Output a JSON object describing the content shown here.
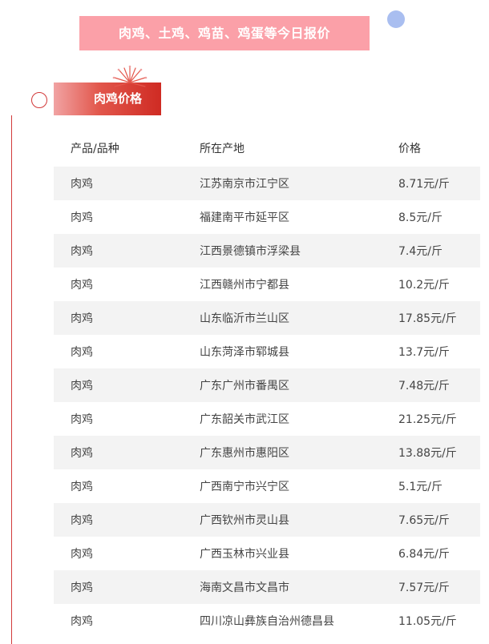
{
  "header": {
    "banner_title": "肉鸡、土鸡、鸡苗、鸡蛋等今日报价"
  },
  "section": {
    "title": "肉鸡价格"
  },
  "colors": {
    "banner_bg": "#fba0a8",
    "accent_red": "#d23a3a",
    "dot_blue": "#a9bef0",
    "row_shade": "#f3f3f3"
  },
  "table": {
    "columns": [
      "产品/品种",
      "所在产地",
      "价格"
    ],
    "rows": [
      {
        "product": "肉鸡",
        "origin": "江苏南京市江宁区",
        "price": "8.71元/斤"
      },
      {
        "product": "肉鸡",
        "origin": "福建南平市延平区",
        "price": "8.5元/斤"
      },
      {
        "product": "肉鸡",
        "origin": "江西景德镇市浮梁县",
        "price": "7.4元/斤"
      },
      {
        "product": "肉鸡",
        "origin": "江西赣州市宁都县",
        "price": "10.2元/斤"
      },
      {
        "product": "肉鸡",
        "origin": "山东临沂市兰山区",
        "price": "17.85元/斤"
      },
      {
        "product": "肉鸡",
        "origin": "山东菏泽市郓城县",
        "price": "13.7元/斤"
      },
      {
        "product": "肉鸡",
        "origin": "广东广州市番禺区",
        "price": "7.48元/斤"
      },
      {
        "product": "肉鸡",
        "origin": "广东韶关市武江区",
        "price": "21.25元/斤"
      },
      {
        "product": "肉鸡",
        "origin": "广东惠州市惠阳区",
        "price": "13.88元/斤"
      },
      {
        "product": "肉鸡",
        "origin": "广西南宁市兴宁区",
        "price": "5.1元/斤"
      },
      {
        "product": "肉鸡",
        "origin": "广西钦州市灵山县",
        "price": "7.65元/斤"
      },
      {
        "product": "肉鸡",
        "origin": "广西玉林市兴业县",
        "price": "6.84元/斤"
      },
      {
        "product": "肉鸡",
        "origin": "海南文昌市文昌市",
        "price": "7.57元/斤"
      },
      {
        "product": "肉鸡",
        "origin": "四川凉山彝族自治州德昌县",
        "price": "11.05元/斤"
      }
    ]
  }
}
